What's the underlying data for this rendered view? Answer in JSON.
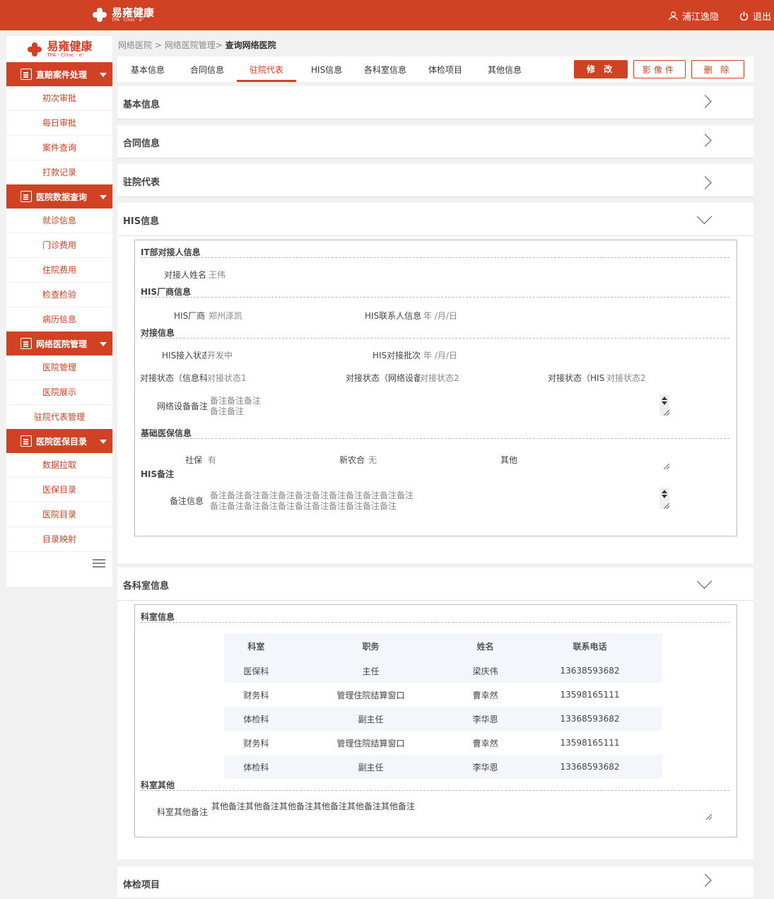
{
  "topbar": {
    "logo_text": "易雍健康",
    "logo_sub": "TPA · Clinic · e⁺",
    "user_name": "浦江逸隐",
    "logout_label": "退出"
  },
  "sidebar": {
    "logo_text": "易雍健康",
    "logo_sub": "TPA · Clinic · e⁺",
    "groups": [
      {
        "label": "直赔案件处理",
        "items": [
          "初次审批",
          "每日审批",
          "案件查询",
          "打款记录"
        ]
      },
      {
        "label": "医院数据查询",
        "items": [
          "就诊信息",
          "门诊费用",
          "住院费用",
          "检查检验",
          "病历信息"
        ]
      },
      {
        "label": "网络医院管理",
        "items": [
          "医院管理",
          "医院展示",
          "驻院代表管理"
        ]
      },
      {
        "label": "医院医保目录",
        "items": [
          "数据拉取",
          "医保目录",
          "医院目录",
          "目录映射"
        ]
      }
    ]
  },
  "breadcrumb": {
    "p1": "网络医院 >",
    "p2": "网络医院管理>",
    "current": "查询网络医院"
  },
  "tabs": [
    "基本信息",
    "合同信息",
    "驻院代表",
    "HIS信息",
    "各科室信息",
    "体检项目",
    "其他信息"
  ],
  "actions": {
    "edit": "修 改",
    "image": "影像件",
    "delete": "删 除"
  },
  "sections": {
    "basic": "基本信息",
    "contract": "合同信息",
    "rep": "驻院代表",
    "his": "HIS信息",
    "dept": "各科室信息",
    "exam": "体检项目"
  },
  "his": {
    "it_title": "IT部对接人信息",
    "contact_label": "对接人姓名",
    "contact_value": "王伟",
    "vendor_title": "HIS厂商信息",
    "vendor_label": "HIS厂商",
    "vendor_value": "郑州泽凯",
    "vendor_contact_label": "HIS联系人信息",
    "vendor_contact_value": "年 /月/日",
    "dock_title": "对接信息",
    "access_label": "HIS接入状态",
    "access_value": "开发中",
    "batch_label": "HIS对接批次",
    "batch_value": "年 /月/日",
    "status1_label": "对接状态（信息科",
    "status1_value": "对接状态1",
    "status2_label": "对接状态（网络设备",
    "status2_value": "对接状态2",
    "status3_label": "对接状态（HIS",
    "status3_value": "对接状态2",
    "netnote_label": "网络设备备注",
    "netnote_line1": "备注备注备注",
    "netnote_line2": "备注备注",
    "insurance_title": "基础医保信息",
    "social_label": "社保",
    "social_value": "有",
    "ncms_label": "新农合",
    "ncms_value": "无",
    "other_label": "其他",
    "note_title": "HIS备注",
    "note_label": "备注信息",
    "note_line1": "备注备注备注备注备注备注备注备注备注备注备注备注",
    "note_line2": "备注备注备注备注备注备注备注备注备注备注备注"
  },
  "dept": {
    "info_title": "科室信息",
    "columns": [
      "科室",
      "职务",
      "姓名",
      "联系电话"
    ],
    "rows": [
      [
        "医保科",
        "主任",
        "梁庆伟",
        "13638593682"
      ],
      [
        "财务科",
        "管理住院结算窗口",
        "曹幸然",
        "13598165111"
      ],
      [
        "体检科",
        "副主任",
        "李华恩",
        "13368593682"
      ],
      [
        "财务科",
        "管理住院结算窗口",
        "曹幸然",
        "13598165111"
      ],
      [
        "体检科",
        "副主任",
        "李华恩",
        "13368593682"
      ]
    ],
    "other_title": "科室其他",
    "other_label": "科室其他备注",
    "other_value": "其他备注其他备注其他备注其他备注其他备注其他备注"
  },
  "colors": {
    "brand": "#d14124"
  }
}
